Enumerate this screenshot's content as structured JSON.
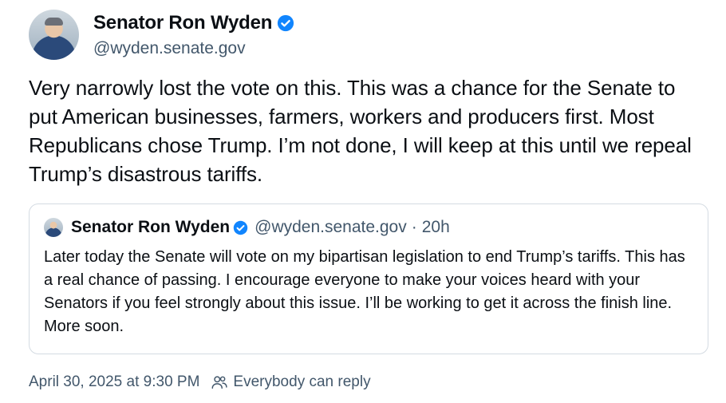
{
  "author": {
    "display_name": "Senator Ron Wyden",
    "handle": "@wyden.senate.gov",
    "verified": true
  },
  "post": {
    "text": "Very narrowly lost the vote on this. This was a chance for the Senate to put American businesses, farmers, workers and producers first. Most Republicans chose Trump. I’m not done, I will keep at this until we repeal Trump’s disastrous tariffs."
  },
  "quote": {
    "display_name": "Senator Ron Wyden",
    "handle": "@wyden.senate.gov",
    "separator": "·",
    "time": "20h",
    "text": "Later today the Senate will vote on my bipartisan legislation to end Trump’s tariffs. This has a real chance of passing. I encourage everyone to make your voices heard with your Senators if you feel strongly about this issue. I’ll be working to get it across the finish line. More soon."
  },
  "footer": {
    "timestamp": "April 30, 2025 at 9:30 PM",
    "reply_setting": "Everybody can reply"
  },
  "icons": {
    "verified": "verified-badge-icon",
    "reply_setting": "people-icon"
  },
  "colors": {
    "verified": "#1185fe",
    "secondary_text": "#42576b",
    "border": "#d4dbe2"
  }
}
